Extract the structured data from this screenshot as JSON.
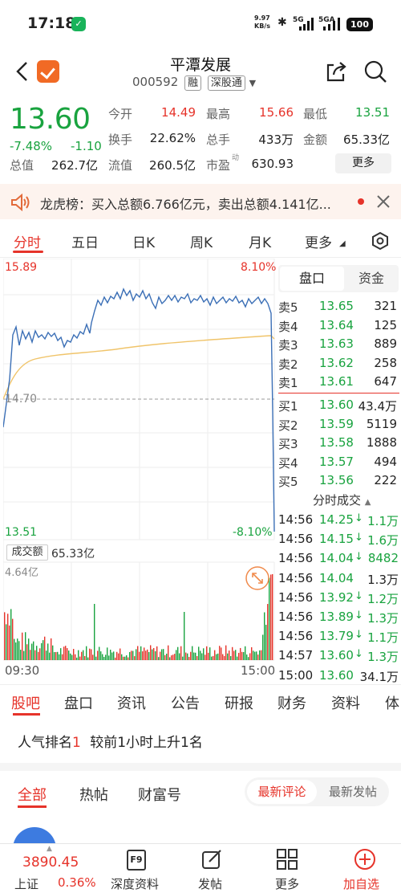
{
  "status": {
    "time": "17:18",
    "net_speed": "9.97",
    "net_unit": "KB/s",
    "sig1": "5G",
    "sig2": "5GA",
    "battery": "100"
  },
  "header": {
    "title": "平潭发展",
    "code": "000592",
    "tag1": "融",
    "tag2": "深股通"
  },
  "quote": {
    "price": "13.60",
    "pct": "-7.48%",
    "change": "-1.10",
    "items": [
      {
        "label": "今开",
        "value": "14.49"
      },
      {
        "label": "最高",
        "value": "15.66"
      },
      {
        "label": "最低",
        "value": "13.51"
      },
      {
        "label": "换手",
        "value": "22.62%"
      },
      {
        "label": "总手",
        "value": "433万"
      },
      {
        "label": "金额",
        "value": "65.33亿"
      },
      {
        "label": "总值",
        "value": "262.7亿"
      },
      {
        "label": "流值",
        "value": "260.5亿"
      },
      {
        "label": "市盈",
        "value": "630.93"
      }
    ],
    "pe_sup": "动",
    "more": "更多"
  },
  "banner": {
    "text": "龙虎榜：买入总额6.766亿元，卖出总额4.141亿..."
  },
  "tabs": [
    "分时",
    "五日",
    "日K",
    "周K",
    "月K",
    "更多"
  ],
  "chart": {
    "y_top": "15.89",
    "y_mid": "14.70",
    "y_bot": "13.51",
    "pct_top": "8.10%",
    "pct_bot": "-8.10%",
    "vol_label": "成交额",
    "vol_value": "65.33亿",
    "vol_max": "4.64亿",
    "t_start": "09:30",
    "t_end": "15:00",
    "colors": {
      "price": "#3b6fb6",
      "avg": "#f0c46a",
      "up": "#e6332a",
      "down": "#19a33f"
    }
  },
  "chart_data": {
    "type": "line",
    "title": "",
    "xlabel": "",
    "ylabel": "",
    "x": [
      "09:30",
      "15:00"
    ],
    "ylim": [
      13.51,
      15.89
    ],
    "series": [
      {
        "values": [
          14.49,
          15.2,
          15.3,
          15.45,
          15.5,
          15.6,
          15.55,
          15.58,
          15.54,
          15.58,
          15.55,
          15.5,
          13.6
        ]
      },
      {
        "values": [
          14.49,
          14.9,
          15.05,
          15.1,
          15.15,
          15.2,
          15.22,
          15.25,
          15.27,
          15.29,
          15.3,
          15.32,
          15.2
        ]
      }
    ],
    "volume_max": "4.64亿"
  },
  "orderbook": {
    "seg_on": "盘口",
    "seg_off": "资金",
    "asks": [
      {
        "k": "卖5",
        "p": "13.65",
        "v": "321"
      },
      {
        "k": "卖4",
        "p": "13.64",
        "v": "125"
      },
      {
        "k": "卖3",
        "p": "13.63",
        "v": "889"
      },
      {
        "k": "卖2",
        "p": "13.62",
        "v": "258"
      },
      {
        "k": "卖1",
        "p": "13.61",
        "v": "647"
      }
    ],
    "bids": [
      {
        "k": "买1",
        "p": "13.60",
        "v": "43.4万"
      },
      {
        "k": "买2",
        "p": "13.59",
        "v": "5119"
      },
      {
        "k": "买3",
        "p": "13.58",
        "v": "1888"
      },
      {
        "k": "买4",
        "p": "13.57",
        "v": "494"
      },
      {
        "k": "买5",
        "p": "13.56",
        "v": "222"
      }
    ],
    "ticks_title": "分时成交",
    "ticks": [
      {
        "t": "14:56",
        "p": "14.25",
        "v": "1.1万",
        "dir": "down"
      },
      {
        "t": "14:56",
        "p": "14.15",
        "v": "1.6万",
        "dir": "down"
      },
      {
        "t": "14:56",
        "p": "14.04",
        "v": "8482",
        "dir": "down"
      },
      {
        "t": "14:56",
        "p": "14.04",
        "v": "1.3万",
        "dir": ""
      },
      {
        "t": "14:56",
        "p": "13.92",
        "v": "1.2万",
        "dir": "down"
      },
      {
        "t": "14:56",
        "p": "13.89",
        "v": "1.3万",
        "dir": "down"
      },
      {
        "t": "14:56",
        "p": "13.79",
        "v": "1.1万",
        "dir": "down"
      },
      {
        "t": "14:57",
        "p": "13.60",
        "v": "1.3万",
        "dir": "down"
      },
      {
        "t": "15:00",
        "p": "13.60",
        "v": "34.1万",
        "dir": ""
      }
    ]
  },
  "bottom_tabs": [
    "股吧",
    "盘口",
    "资讯",
    "公告",
    "研报",
    "财务",
    "资料",
    "体"
  ],
  "popularity": {
    "prefix": "人气排名",
    "rank": "1",
    "suffix": "较前1小时上升1名"
  },
  "content_tabs": [
    "全部",
    "热帖",
    "财富号"
  ],
  "sort": {
    "on": "最新评论",
    "off": "最新发帖"
  },
  "bottom_bar": {
    "index_value": "3890.45",
    "index_name": "上证",
    "index_pct": "0.36%",
    "items": [
      "深度资料",
      "发帖",
      "更多",
      "加自选"
    ],
    "f9": "F9"
  }
}
